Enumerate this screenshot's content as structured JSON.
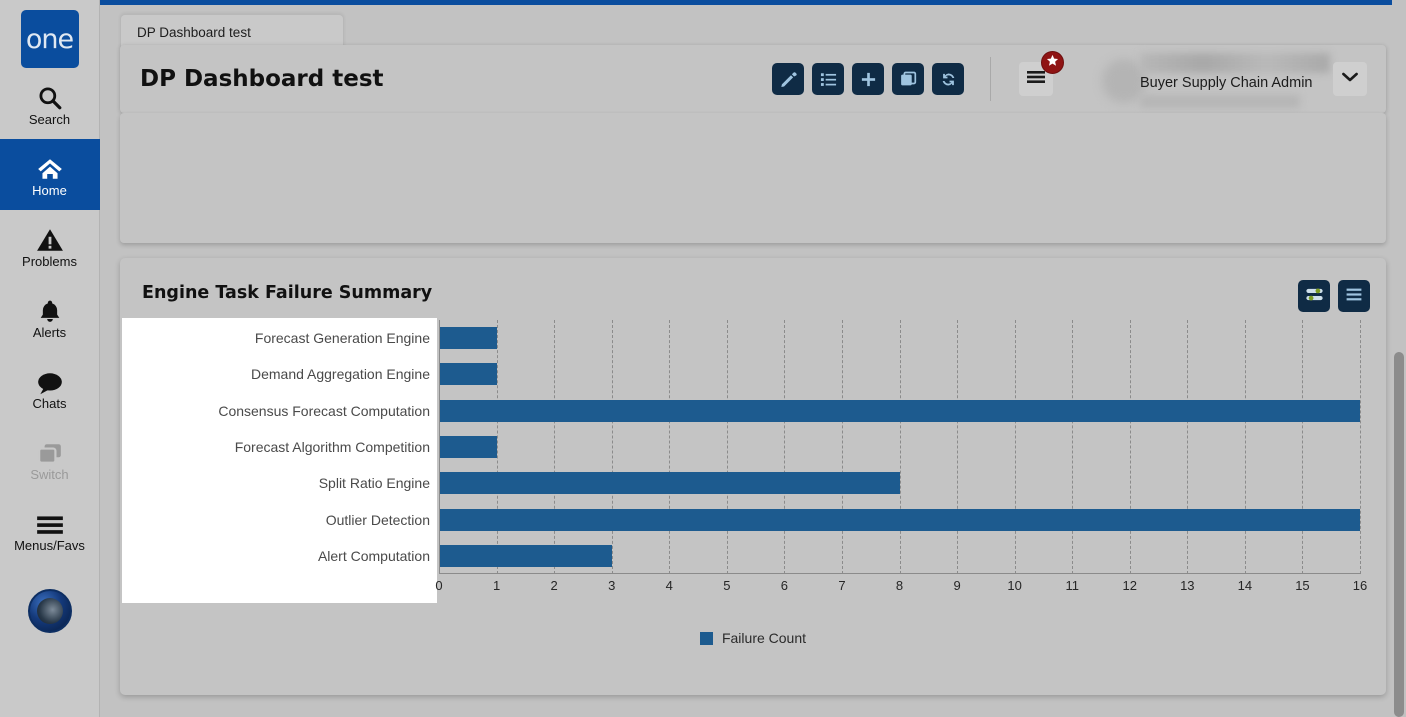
{
  "sidebar": {
    "logo_label": "one",
    "items": [
      {
        "label": "Search",
        "icon": "search-icon",
        "state": "normal"
      },
      {
        "label": "Home",
        "icon": "home-icon",
        "state": "active"
      },
      {
        "label": "Problems",
        "icon": "warning-triangle-icon",
        "state": "normal"
      },
      {
        "label": "Alerts",
        "icon": "bell-icon",
        "state": "normal"
      },
      {
        "label": "Chats",
        "icon": "chat-bubble-icon",
        "state": "normal"
      },
      {
        "label": "Switch",
        "icon": "switch-windows-icon",
        "state": "disabled"
      },
      {
        "label": "Menus/Favs",
        "icon": "hamburger-icon",
        "state": "normal"
      }
    ]
  },
  "tab": {
    "label": "DP Dashboard test"
  },
  "header": {
    "title": "DP Dashboard test",
    "toolbar": [
      {
        "name": "edit-button",
        "icon": "pencil-icon"
      },
      {
        "name": "list-button",
        "icon": "list-icon"
      },
      {
        "name": "add-button",
        "icon": "plus-icon"
      },
      {
        "name": "copy-button",
        "icon": "copy-icon"
      },
      {
        "name": "refresh-button",
        "icon": "refresh-icon"
      }
    ],
    "menu_icon": "hamburger-icon",
    "badge_icon": "star-icon",
    "user_role": "Buyer Supply Chain Admin",
    "chevron_icon": "chevron-down-icon"
  },
  "chart_panel": {
    "title": "Engine Task Failure Summary",
    "actions": [
      {
        "name": "filter-settings-button",
        "icon": "sliders-icon"
      },
      {
        "name": "panel-menu-button",
        "icon": "hamburger-icon"
      }
    ]
  },
  "colors": {
    "bar": "#1d5b8f",
    "accent_blue": "#0a4d9e",
    "toolbar_dark": "#0f2b45",
    "badge_red": "#8f1414",
    "panel_bg": "#c4c4c4"
  },
  "chart_data": {
    "type": "bar",
    "orientation": "horizontal",
    "title": "Engine Task Failure Summary",
    "categories": [
      "Forecast Generation Engine",
      "Demand Aggregation Engine",
      "Consensus Forecast Computation",
      "Forecast Algorithm Competition",
      "Split Ratio Engine",
      "Outlier Detection",
      "Alert Computation"
    ],
    "series": [
      {
        "name": "Failure Count",
        "values": [
          1,
          1,
          16,
          1,
          8,
          16,
          3
        ],
        "color": "#1d5b8f"
      }
    ],
    "xlabel": "",
    "ylabel": "",
    "xlim": [
      0,
      16
    ],
    "xticks": [
      0,
      1,
      2,
      3,
      4,
      5,
      6,
      7,
      8,
      9,
      10,
      11,
      12,
      13,
      14,
      15,
      16
    ],
    "grid": true,
    "grid_style": "dashed-vertical",
    "legend": {
      "position": "bottom",
      "entries": [
        "Failure Count"
      ]
    }
  }
}
